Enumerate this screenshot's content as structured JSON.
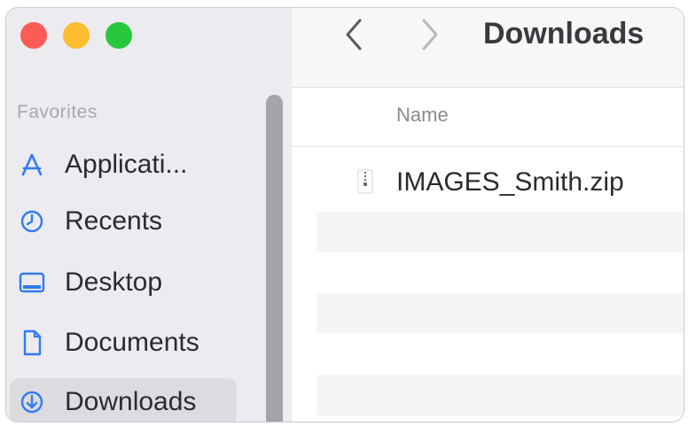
{
  "sidebar": {
    "section_label": "Favorites",
    "items": [
      {
        "label": "Applicati...",
        "icon": "applications-icon"
      },
      {
        "label": "Recents",
        "icon": "clock-icon"
      },
      {
        "label": "Desktop",
        "icon": "desktop-icon"
      },
      {
        "label": "Documents",
        "icon": "document-icon"
      },
      {
        "label": "Downloads",
        "icon": "download-icon",
        "selected": true
      }
    ]
  },
  "toolbar": {
    "title": "Downloads"
  },
  "list": {
    "column_name": "Name",
    "files": [
      {
        "name": "IMAGES_Smith.zip",
        "icon": "zip-file-icon"
      }
    ]
  },
  "colors": {
    "accent": "#2f7bf5",
    "close": "#fd5c55",
    "minimize": "#fdbd2e",
    "zoom": "#27c840"
  }
}
